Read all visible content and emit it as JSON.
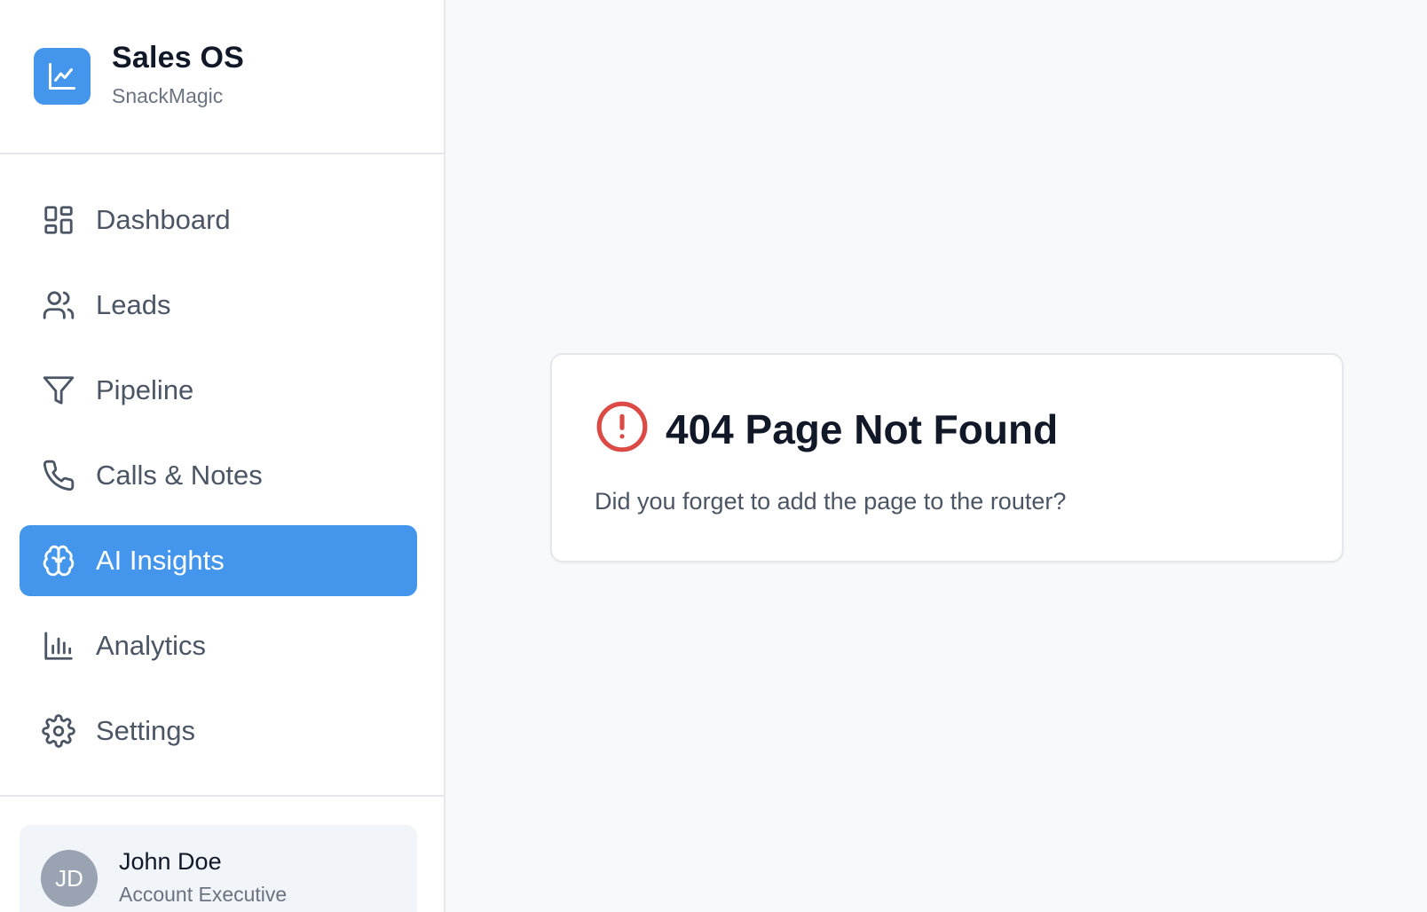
{
  "brand": {
    "title": "Sales OS",
    "subtitle": "SnackMagic",
    "icon": "line-chart-icon",
    "color": "#4496ec"
  },
  "sidebar": {
    "items": [
      {
        "label": "Dashboard",
        "icon": "dashboard-icon",
        "active": false
      },
      {
        "label": "Leads",
        "icon": "users-icon",
        "active": false
      },
      {
        "label": "Pipeline",
        "icon": "funnel-icon",
        "active": false
      },
      {
        "label": "Calls & Notes",
        "icon": "phone-icon",
        "active": false
      },
      {
        "label": "AI Insights",
        "icon": "brain-icon",
        "active": true
      },
      {
        "label": "Analytics",
        "icon": "bar-chart-icon",
        "active": false
      },
      {
        "label": "Settings",
        "icon": "gear-icon",
        "active": false
      }
    ],
    "active_color": "#4496ec"
  },
  "user": {
    "initials": "JD",
    "name": "John Doe",
    "role": "Account Executive"
  },
  "error": {
    "title": "404 Page Not Found",
    "message": "Did you forget to add the page to the router?",
    "icon": "alert-circle-icon",
    "icon_color": "#dc4a45"
  }
}
